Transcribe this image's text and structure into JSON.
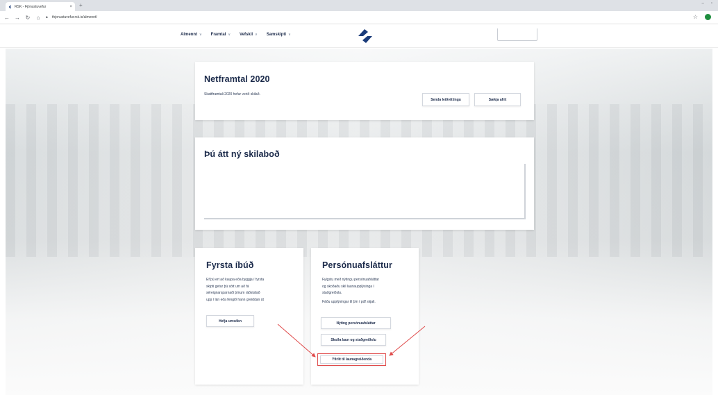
{
  "browser": {
    "tab_title": "RSK - Þjónustuvefur",
    "tab_close": "×",
    "new_tab": "+",
    "url": "thjonustuvefur.rsk.is/almennt/",
    "window_controls": [
      "–",
      "▫"
    ]
  },
  "nav": {
    "items": [
      {
        "label": "Almennt"
      },
      {
        "label": "Framtal"
      },
      {
        "label": "Vefskil"
      },
      {
        "label": "Samskipti"
      }
    ]
  },
  "tax_return": {
    "title": "Netframtal 2020",
    "text": "Skattframtali 2020 hefur verið skilað.",
    "correct_button": "Senda leiðréttingu",
    "copy_button": "Sækja afrit"
  },
  "messages": {
    "title": "Þú átt ný skilaboð"
  },
  "first_home": {
    "title": "Fyrsta íbúð",
    "body_lines": [
      "Ef þú ert að kaupa eða byggja í fyrsta",
      "skipti getur þú sótt um að fá",
      "séreignarsparnaði þínum ráðstafað",
      "upp í lán eða fengið hann greiddan út"
    ],
    "apply_button": "Hefja umsókn"
  },
  "personal_allowance": {
    "title": "Persónuafsláttur",
    "body_lines": [
      "Fylgstu með nýtingu persónuafsláttar",
      "og skoðaðu skil launaupplýsinga í",
      "staðgreiðslu."
    ],
    "body_line_2": "Fáðu upplýsingar til þín í pdf skjali.",
    "usage_button": "Nýting persónuafsláttar",
    "salary_button": "Skoða laun og staðgreiðslu",
    "overview_button": "Yfirlit til launagreiðenda"
  },
  "colors": {
    "brand": "#1b2a4a",
    "annotation": "#e04b4b"
  }
}
